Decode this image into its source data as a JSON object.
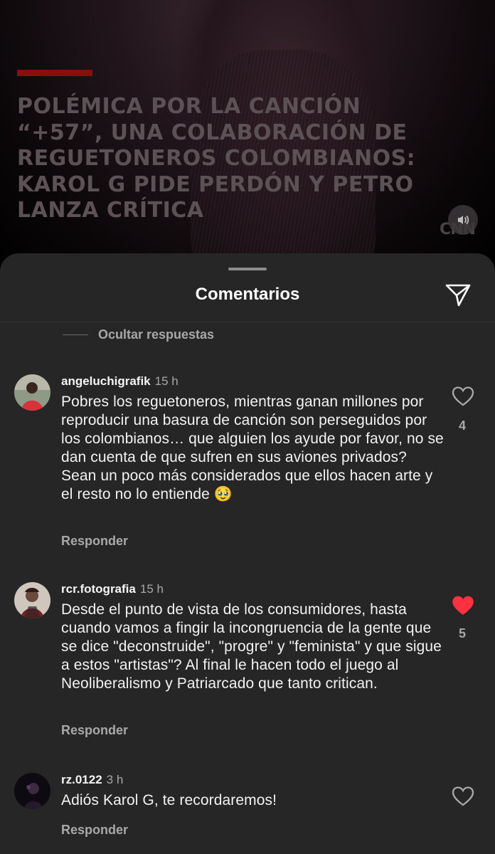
{
  "post": {
    "headline": "POLÉMICA POR LA CANCIÓN “+57”, UNA COLABORACIÓN DE REGUETONEROS COLOMBIANOS: KAROL G PIDE PERDÓN Y PETRO LANZA CRÍTICA",
    "source_logo": "CNN"
  },
  "sheet": {
    "title": "Comentarios",
    "hide_replies": "Ocultar respuestas"
  },
  "comments": [
    {
      "user": "angeluchigrafik",
      "time": "15 h",
      "text": "Pobres los reguetoneros, mientras ganan millones por reproducir una basura de canción son perseguidos por los colombianos… que alguien los ayude por favor, no se dan cuenta de que sufren en sus aviones privados? Sean un poco más considerados que ellos hacen arte y el resto no lo entiende 🥹",
      "reply": "Responder",
      "likes": "4",
      "liked": false
    },
    {
      "user": "rcr.fotografia",
      "time": "15 h",
      "text": "Desde el punto de vista de los consumidores, hasta cuando vamos a fingir la incongruencia de la gente que se dice \"deconstruide\", \"progre\" y \"feminista\" y que sigue a estos \"artistas\"? Al final le hacen todo el juego al Neoliberalismo y Patriarcado que tanto critican.",
      "reply": "Responder",
      "likes": "5",
      "liked": true
    },
    {
      "user": "rz.0122",
      "time": "3 h",
      "text": "Adiós Karol G, te recordaremos!",
      "reply": "Responder",
      "likes": "",
      "liked": false
    }
  ],
  "colors": {
    "sheet_bg": "#262626",
    "liked_heart": "#ff3040",
    "muted_text": "#a8a8a8",
    "accent_bar": "#8a0e0e"
  }
}
